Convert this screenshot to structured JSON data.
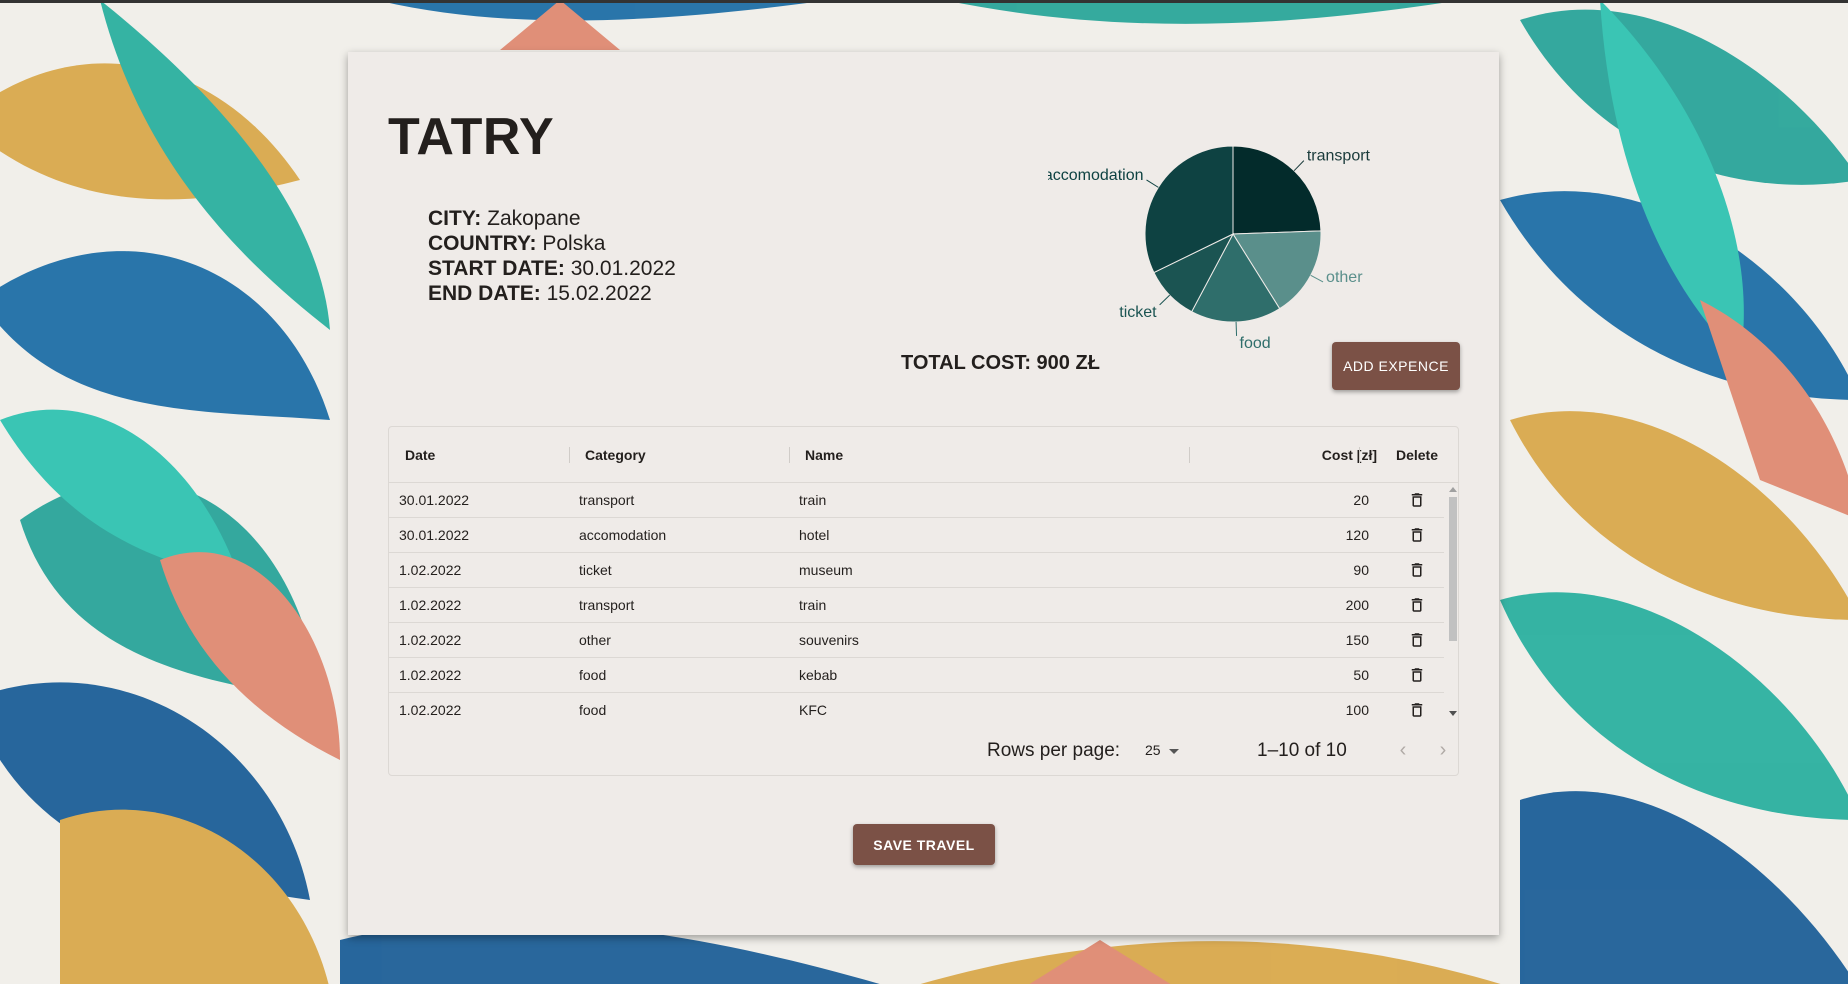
{
  "trip": {
    "title": "TATRY",
    "city_label": "CITY:",
    "city": "Zakopane",
    "country_label": "COUNTRY:",
    "country": "Polska",
    "start_label": "START DATE:",
    "start_date": "30.01.2022",
    "end_label": "END DATE:",
    "end_date": "15.02.2022"
  },
  "summary": {
    "total_label": "TOTAL COST: 900 ZŁ",
    "add_button": "ADD EXPENCE",
    "save_button": "SAVE TRAVEL"
  },
  "chart_data": {
    "type": "pie",
    "title": "",
    "slices": [
      {
        "label": "transport",
        "value": 220,
        "color": "#032b2b"
      },
      {
        "label": "other",
        "value": 150,
        "color": "#5a8f8b"
      },
      {
        "label": "food",
        "value": 150,
        "color": "#2f6e6b"
      },
      {
        "label": "ticket",
        "value": 90,
        "color": "#1b5452"
      },
      {
        "label": "accomodation",
        "value": 290,
        "color": "#0e4242"
      }
    ],
    "label_colors": {
      "transport": "#1a3b3b",
      "other": "#5a8f8b",
      "food": "#2f6e6b",
      "ticket": "#1b5452",
      "accomodation": "#0e4242"
    }
  },
  "table": {
    "headers": {
      "date": "Date",
      "category": "Category",
      "name": "Name",
      "cost": "Cost [zł]",
      "delete": "Delete"
    },
    "rows": [
      {
        "date": "30.01.2022",
        "category": "transport",
        "name": "train",
        "cost": "20"
      },
      {
        "date": "30.01.2022",
        "category": "accomodation",
        "name": "hotel",
        "cost": "120"
      },
      {
        "date": "1.02.2022",
        "category": "ticket",
        "name": "museum",
        "cost": "90"
      },
      {
        "date": "1.02.2022",
        "category": "transport",
        "name": "train",
        "cost": "200"
      },
      {
        "date": "1.02.2022",
        "category": "other",
        "name": "souvenirs",
        "cost": "150"
      },
      {
        "date": "1.02.2022",
        "category": "food",
        "name": "kebab",
        "cost": "50"
      },
      {
        "date": "1.02.2022",
        "category": "food",
        "name": "KFC",
        "cost": "100"
      }
    ],
    "delete_icon": "trash-icon"
  },
  "pagination": {
    "rows_per_page_label": "Rows per page:",
    "rows_per_page_value": "25",
    "range": "1–10 of 10",
    "prev_icon": "chevron-left-icon",
    "next_icon": "chevron-right-icon"
  },
  "colors": {
    "card_bg": "#efebe8",
    "button_bg": "#7b5146",
    "text": "#231f1d"
  }
}
